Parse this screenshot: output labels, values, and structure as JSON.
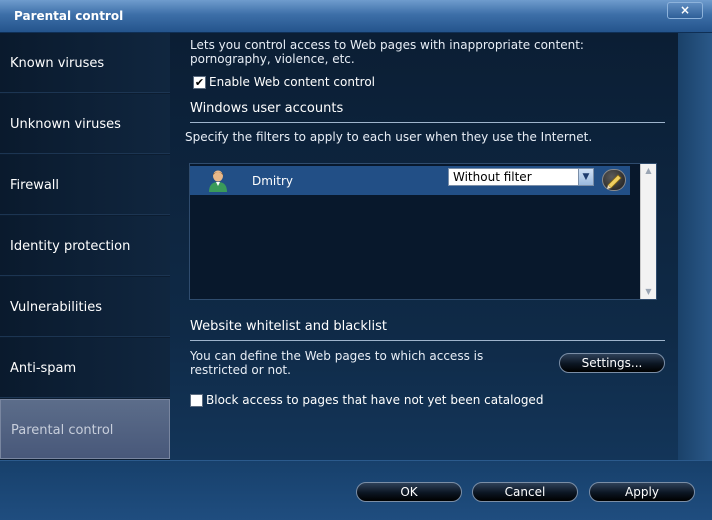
{
  "window": {
    "title": "Parental control",
    "close_label": "×"
  },
  "sidebar": {
    "items": [
      {
        "label": "Known viruses"
      },
      {
        "label": "Unknown viruses"
      },
      {
        "label": "Firewall"
      },
      {
        "label": "Identity protection"
      },
      {
        "label": "Vulnerabilities"
      },
      {
        "label": "Anti-spam"
      },
      {
        "label": "Parental control"
      }
    ],
    "active": "Parental control"
  },
  "main": {
    "description": "Lets you control access to Web pages with inappropriate content: pornography, violence, etc.",
    "enable_web_control": {
      "label": "Enable Web content control",
      "checked": true
    },
    "accounts_section": {
      "title": "Windows user accounts",
      "description": "Specify the filters to apply to each user when they use the Internet.",
      "users": [
        {
          "name": "Dmitry",
          "filter": "Without filter"
        }
      ]
    },
    "whitelist_section": {
      "title": "Website whitelist and blacklist",
      "description": "You can define the Web pages to which access is restricted or not.",
      "settings_label": "Settings..."
    },
    "block_uncataloged": {
      "label": "Block access to pages that have not yet been cataloged",
      "checked": false
    }
  },
  "footer": {
    "ok_label": "OK",
    "cancel_label": "Cancel",
    "apply_label": "Apply"
  },
  "colors": {
    "title_bar": "#3d6fa8",
    "sidebar_bg": "#0c1d31",
    "active_item": "#5c6d8a",
    "selected_row": "#224f86",
    "footer_bg": "#1f4d7f"
  }
}
